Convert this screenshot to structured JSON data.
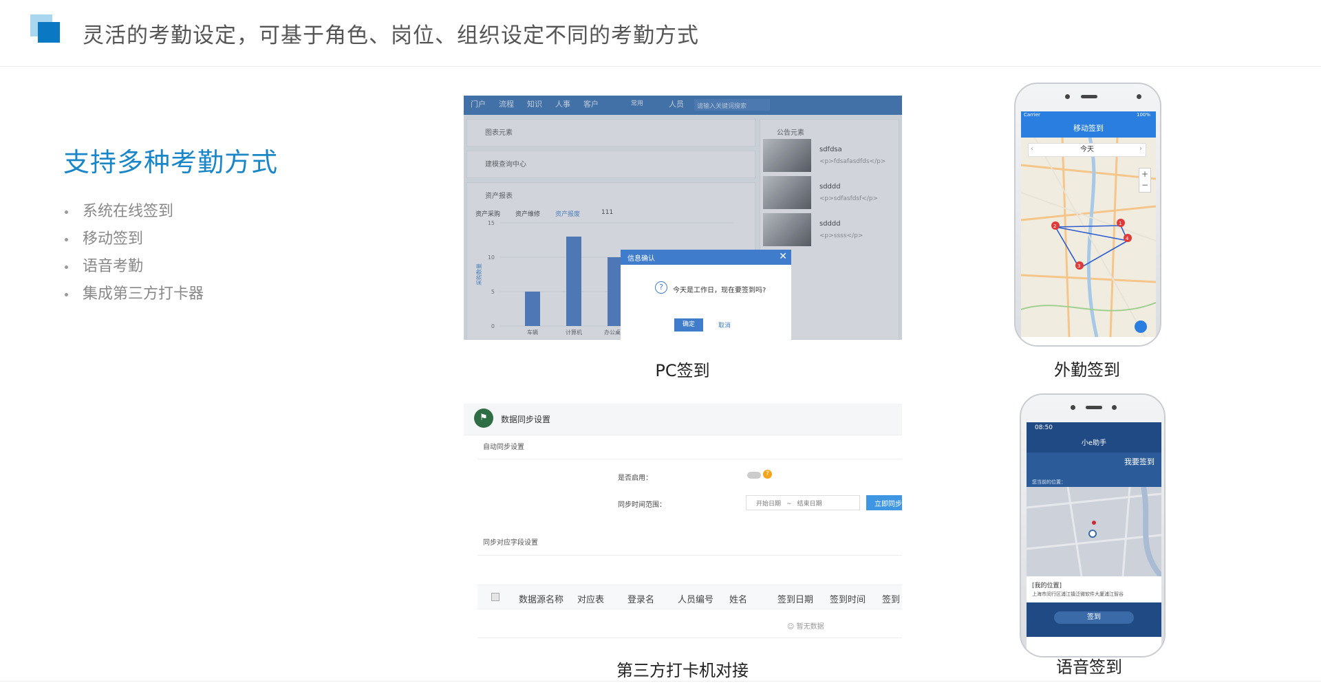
{
  "header": {
    "title": "灵活的考勤设定，可基于角色、岗位、组织设定不同的考勤方式"
  },
  "feature": {
    "heading": "支持多种考勤方式",
    "items": [
      "系统在线签到",
      "移动签到",
      "语音考勤",
      "集成第三方打卡器"
    ]
  },
  "captions": {
    "pc": "PC签到",
    "field": "外勤签到",
    "third_party": "第三方打卡机对接",
    "voice": "语音签到"
  },
  "pc_screen": {
    "nav": [
      "门户",
      "流程",
      "知识",
      "人事",
      "客户",
      "常用",
      "人员"
    ],
    "search_placeholder": "请输入关键词搜索",
    "panels": [
      "图表元素",
      "建模查询中心",
      "资产报表",
      "公告元素"
    ],
    "report_tabs": [
      "资产采购",
      "资产维修",
      "资产报废",
      "111"
    ],
    "chart_data": {
      "type": "bar",
      "categories": [
        "车辆",
        "计算机",
        "办公桌椅"
      ],
      "values": [
        5,
        13,
        10
      ],
      "ylim": [
        0,
        15
      ],
      "yticks": [
        0,
        5,
        10,
        15
      ],
      "ylabel": "采购数量"
    },
    "notices": [
      {
        "title": "sdfdsa",
        "body": "<p>fdsafasdfds</p>"
      },
      {
        "title": "sdddd",
        "body": "<p>sdfasfdsf</p>"
      },
      {
        "title": "sdddd",
        "body": "<p>ssss</p>"
      }
    ],
    "dialog": {
      "title": "信息确认",
      "message": "今天是工作日，现在要签到吗?",
      "ok": "确定",
      "cancel": "取消"
    }
  },
  "mobile_field": {
    "status": "Carrier",
    "battery": "100%",
    "title": "移动签到",
    "date": "今天",
    "markers": [
      "1",
      "2",
      "3",
      "4"
    ]
  },
  "mobile_voice": {
    "time": "08:50",
    "title": "小e助手",
    "sign_label": "我要签到",
    "location_hint": "您当前的位置：",
    "my_position": "[我的位置]",
    "address": "上海市闵行区浦江镇泛微软件大厦浦江智谷",
    "button": "签到"
  },
  "third_party_screen": {
    "title": "数据同步设置",
    "auto_section": "自动同步设置",
    "enable_label": "是否启用：",
    "range_label": "同步时间范围：",
    "start_placeholder": "开始日期",
    "range_sep": "~",
    "end_placeholder": "结束日期",
    "sync_now": "立即同步",
    "field_section": "同步对应字段设置",
    "columns": [
      "数据源名称",
      "对应表",
      "登录名",
      "人员编号",
      "姓名",
      "签到日期",
      "签到时间",
      "签到"
    ],
    "empty": "暂无数据"
  }
}
